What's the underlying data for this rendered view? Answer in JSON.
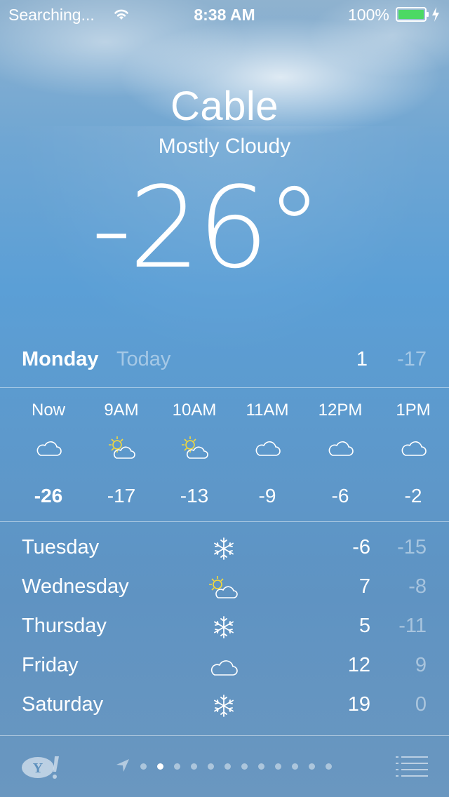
{
  "status_bar": {
    "carrier": "Searching...",
    "time": "8:38 AM",
    "battery": "100%"
  },
  "location": {
    "city": "Cable",
    "condition": "Mostly Cloudy",
    "temperature": "-26°"
  },
  "today": {
    "day": "Monday",
    "label": "Today",
    "high": "1",
    "low": "-17"
  },
  "hourly": [
    {
      "time": "Now",
      "icon": "cloud-icon",
      "temp": "-26"
    },
    {
      "time": "9AM",
      "icon": "partly-sunny-icon",
      "temp": "-17"
    },
    {
      "time": "10AM",
      "icon": "partly-sunny-icon",
      "temp": "-13"
    },
    {
      "time": "11AM",
      "icon": "cloud-icon",
      "temp": "-9"
    },
    {
      "time": "12PM",
      "icon": "cloud-icon",
      "temp": "-6"
    },
    {
      "time": "1PM",
      "icon": "cloud-icon",
      "temp": "-2"
    }
  ],
  "daily": [
    {
      "day": "Tuesday",
      "icon": "snowflake-icon",
      "high": "-6",
      "low": "-15"
    },
    {
      "day": "Wednesday",
      "icon": "partly-sunny-icon",
      "high": "7",
      "low": "-8"
    },
    {
      "day": "Thursday",
      "icon": "snowflake-icon",
      "high": "5",
      "low": "-11"
    },
    {
      "day": "Friday",
      "icon": "cloud-icon",
      "high": "12",
      "low": "9"
    },
    {
      "day": "Saturday",
      "icon": "snowflake-icon",
      "high": "19",
      "low": "0"
    }
  ],
  "pager": {
    "total_pages": 12,
    "active_index": 1
  },
  "colors": {
    "sun": "#f4d93a",
    "battery": "#4cd964",
    "dim_text": "rgba(255,255,255,0.45)"
  }
}
